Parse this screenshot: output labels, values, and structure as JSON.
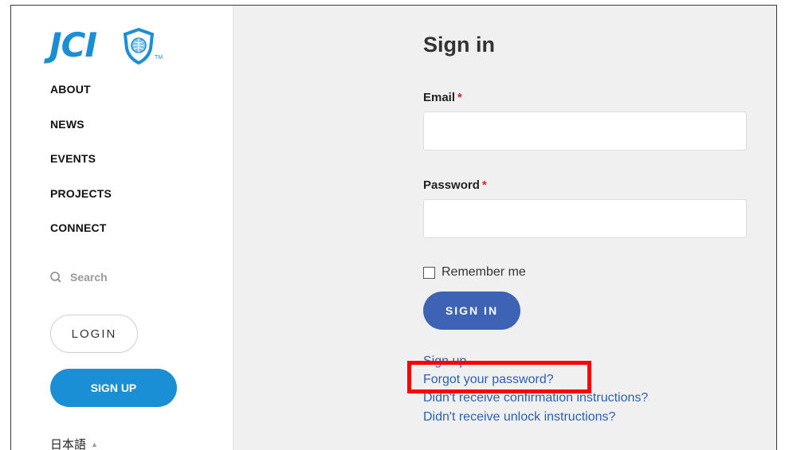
{
  "brand": {
    "logo_text": "JCI",
    "tm": "TM",
    "accent": "#1b8fd6"
  },
  "nav": [
    {
      "label": "ABOUT"
    },
    {
      "label": "NEWS"
    },
    {
      "label": "EVENTS"
    },
    {
      "label": "PROJECTS"
    },
    {
      "label": "CONNECT"
    }
  ],
  "search": {
    "label": "Search",
    "icon": "search-icon"
  },
  "auth": {
    "login_label": "LOGIN",
    "signup_label": "SIGN UP"
  },
  "language": {
    "label": "日本語",
    "icon": "caret-up-icon"
  },
  "form": {
    "title": "Sign in",
    "email_label": "Email",
    "password_label": "Password",
    "required_mark": "*",
    "email_value": "",
    "password_value": "",
    "remember_label": "Remember me",
    "remember_checked": false,
    "submit_label": "SIGN IN",
    "submit_color": "#3e63b5"
  },
  "links": {
    "sign_up": "Sign up",
    "forgot_password": "Forgot your password?",
    "confirmation": "Didn't receive confirmation instructions?",
    "unlock": "Didn't receive unlock instructions?"
  },
  "annotation": {
    "highlight_color": "#ff0000"
  }
}
